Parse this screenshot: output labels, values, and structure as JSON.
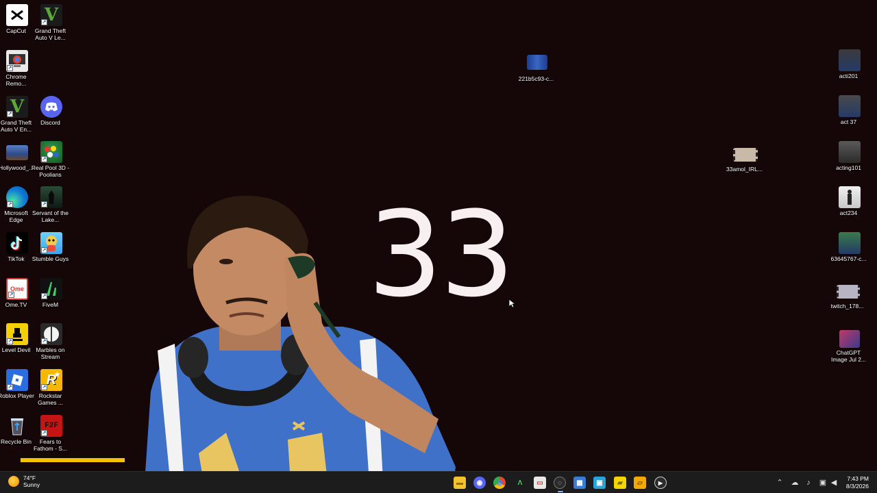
{
  "desktop_icons_left": [
    {
      "label": "CapCut",
      "icon": "capcut-icon",
      "color": "#111111"
    },
    {
      "label": "Grand Theft Auto V Le...",
      "icon": "gta-v-icon",
      "color": "#1b1b1b"
    },
    {
      "label": "Chrome Remo...",
      "icon": "chrome-remote-icon",
      "color": "#2b6bd6"
    },
    {
      "label": "Grand Theft Auto V En...",
      "icon": "gta-v-icon",
      "color": "#1b1b1b"
    },
    {
      "label": "Discord",
      "icon": "discord-icon",
      "color": "#5865f2"
    },
    {
      "label": "Hollywood_...",
      "icon": "image-file-icon",
      "color": "#2d4a8a"
    },
    {
      "label": "Real Pool 3D - Poolians",
      "icon": "pool-game-icon",
      "color": "#1f7a3a"
    },
    {
      "label": "Microsoft Edge",
      "icon": "edge-icon",
      "color": "#0f7bd6"
    },
    {
      "label": "Servant of the Lake...",
      "icon": "servant-game-icon",
      "color": "#1e3a2a"
    },
    {
      "label": "TikTok",
      "icon": "tiktok-icon",
      "color": "#000000"
    },
    {
      "label": "Stumble Guys",
      "icon": "stumble-guys-icon",
      "color": "#3aa7e6"
    },
    {
      "label": "Ome.TV",
      "icon": "ometv-icon",
      "color": "#d63a2a"
    },
    {
      "label": "FiveM",
      "icon": "fivem-icon",
      "color": "#111111"
    },
    {
      "label": "Level Devil",
      "icon": "level-devil-icon",
      "color": "#f3d000"
    },
    {
      "label": "Marbles on Stream",
      "icon": "marbles-icon",
      "color": "#333333"
    },
    {
      "label": "Roblox Player",
      "icon": "roblox-icon",
      "color": "#2a6de0"
    },
    {
      "label": "Rockstar Games ...",
      "icon": "rockstar-icon",
      "color": "#f5b800"
    },
    {
      "label": "Recycle Bin",
      "icon": "recycle-bin-icon",
      "color": "#3b3b3b"
    },
    {
      "label": "Fears to Fathom - S...",
      "icon": "fears-to-fathom-icon",
      "color": "#c41414"
    }
  ],
  "desktop_icons_right": [
    {
      "label": "221b5c93-c...",
      "icon": "image-file-icon",
      "color": "#1e3c8c"
    },
    {
      "label": "acti201",
      "icon": "image-file-icon",
      "color": "#243a66"
    },
    {
      "label": "act 37",
      "icon": "image-file-icon",
      "color": "#243a66"
    },
    {
      "label": "33amol_IRL...",
      "icon": "video-file-icon",
      "color": "#c9b9a8"
    },
    {
      "label": "acting101",
      "icon": "image-file-icon",
      "color": "#4a4a4a"
    },
    {
      "label": "act234",
      "icon": "image-file-icon",
      "color": "#d8d8d8"
    },
    {
      "label": "63645767-c...",
      "icon": "image-file-icon",
      "color": "#2e5a3a"
    },
    {
      "label": "twitch_178...",
      "icon": "video-file-icon",
      "color": "#b9b4c4"
    },
    {
      "label": "ChatGPT Image Jul 2...",
      "icon": "image-file-icon",
      "color": "#7a3a5a"
    }
  ],
  "counter": {
    "value": "33"
  },
  "taskbar": {
    "weather_temp": "74°F",
    "weather_desc": "Sunny",
    "apps": [
      {
        "name": "file-explorer-icon",
        "color": "#f2c230",
        "glyph": "▬"
      },
      {
        "name": "discord-taskbar-icon",
        "color": "#5865f2",
        "glyph": "◉"
      },
      {
        "name": "chrome-icon",
        "color": "#34a853",
        "glyph": "◎"
      },
      {
        "name": "fivem-taskbar-icon",
        "color": "#1c1c1c",
        "glyph": "Λ"
      },
      {
        "name": "capcut-taskbar-icon",
        "color": "#e8e8e8",
        "glyph": "▭"
      },
      {
        "name": "obs-icon",
        "color": "#2b2b2b",
        "glyph": "◌"
      },
      {
        "name": "store-icon",
        "color": "#3a7bd5",
        "glyph": "▦"
      },
      {
        "name": "photos-icon",
        "color": "#2aa3d6",
        "glyph": "▣"
      },
      {
        "name": "sticky-notes-icon",
        "color": "#f5d400",
        "glyph": "▰"
      },
      {
        "name": "notes-icon",
        "color": "#f5a800",
        "glyph": "▱"
      },
      {
        "name": "media-player-icon",
        "color": "#2b2b2b",
        "glyph": "▶"
      }
    ],
    "time": "7:43 PM",
    "date": "8/3/2026"
  }
}
